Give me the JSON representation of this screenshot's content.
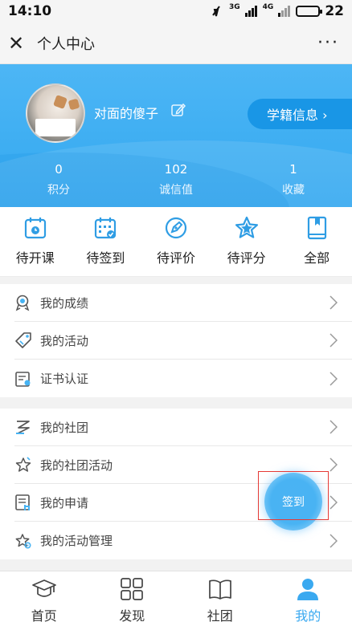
{
  "status": {
    "time": "14:10",
    "signal1": "3G",
    "signal2": "4G",
    "battery": "22"
  },
  "titlebar": {
    "title": "个人中心",
    "close_icon": "close-icon",
    "more": "···"
  },
  "profile": {
    "nickname": "对面的傻子",
    "xueji_label": "学籍信息 ›"
  },
  "stats": [
    {
      "value": "0",
      "label": "积分"
    },
    {
      "value": "102",
      "label": "诚信值"
    },
    {
      "value": "1",
      "label": "收藏"
    }
  ],
  "quick": [
    {
      "label": "待开课",
      "icon": "calendar-clock-icon"
    },
    {
      "label": "待签到",
      "icon": "calendar-check-icon"
    },
    {
      "label": "待评价",
      "icon": "pen-circle-icon"
    },
    {
      "label": "待评分",
      "icon": "star-icon"
    },
    {
      "label": "全部",
      "icon": "book-icon"
    }
  ],
  "group1": [
    {
      "label": "我的成绩",
      "icon": "search-medal-icon"
    },
    {
      "label": "我的活动",
      "icon": "tag-icon"
    },
    {
      "label": "证书认证",
      "icon": "certificate-icon"
    }
  ],
  "group2": [
    {
      "label": "我的社团",
      "icon": "club-icon"
    },
    {
      "label": "我的社团活动",
      "icon": "star-outline-icon"
    },
    {
      "label": "我的申请",
      "icon": "application-icon"
    },
    {
      "label": "我的活动管理",
      "icon": "star-gear-icon"
    }
  ],
  "fab": {
    "label": "签到"
  },
  "tabs": [
    {
      "label": "首页",
      "icon": "graduation-cap-icon",
      "active": false
    },
    {
      "label": "发现",
      "icon": "grid-icon",
      "active": false
    },
    {
      "label": "社团",
      "icon": "open-book-icon",
      "active": false
    },
    {
      "label": "我的",
      "icon": "user-icon",
      "active": true
    }
  ],
  "colors": {
    "accent": "#3aa9f0",
    "header": "#40b0f3",
    "highlight": "#e53935"
  }
}
